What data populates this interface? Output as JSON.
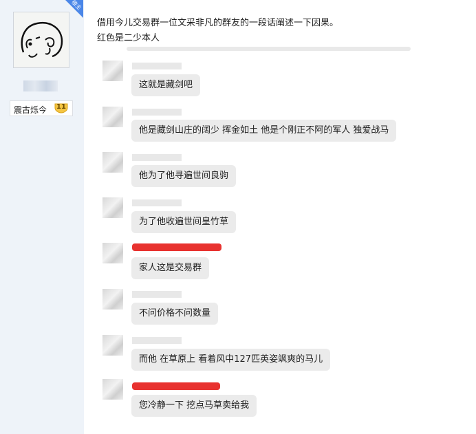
{
  "sidebar": {
    "badge_label": "楼主",
    "username": "震古烁今",
    "level": "11"
  },
  "post": {
    "line1": "借用今儿交易群一位文采非凡的群友的一段话阐述一下因果。",
    "line2": "红色是二少本人"
  },
  "messages": [
    {
      "text": "这就是藏剑吧",
      "name_highlight": false
    },
    {
      "text": "他是藏剑山庄的阔少  挥金如土  他是个刚正不阿的军人 独爱战马",
      "name_highlight": false
    },
    {
      "text": "他为了他寻遍世间良驹",
      "name_highlight": false
    },
    {
      "text": "为了他收遍世间皇竹草",
      "name_highlight": false
    },
    {
      "text": "家人这是交易群",
      "name_highlight": true
    },
    {
      "text": "不问价格不问数量",
      "name_highlight": false
    },
    {
      "text": "而他 在草原上 看着风中127匹英姿飒爽的马儿",
      "name_highlight": false
    },
    {
      "text": "您冷静一下 挖点马草卖给我",
      "name_highlight": true
    }
  ],
  "colors": {
    "highlight_red": "#e8322f",
    "ribbon_blue": "#4a86e8",
    "bubble_gray": "#ebebeb",
    "level_gold": "#f5c542"
  }
}
